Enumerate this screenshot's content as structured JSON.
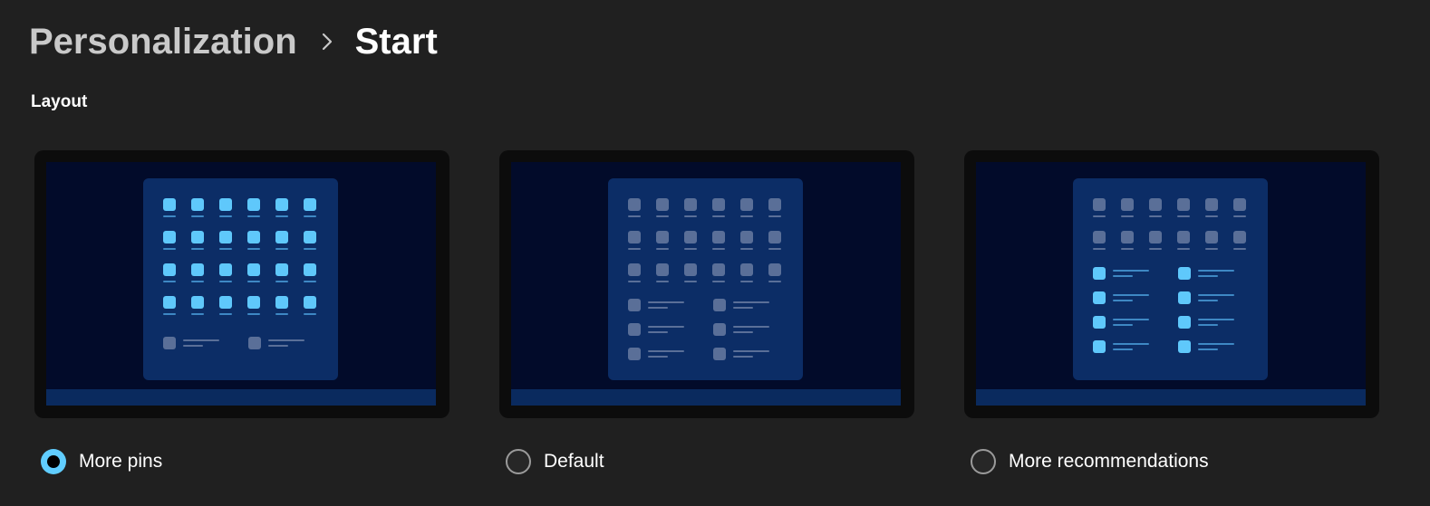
{
  "header": {
    "parent": "Personalization",
    "separator_icon": "chevron-right-icon",
    "current": "Start"
  },
  "section": {
    "title": "Layout"
  },
  "options": [
    {
      "id": "more-pins",
      "label": "More pins",
      "selected": true
    },
    {
      "id": "default",
      "label": "Default",
      "selected": false
    },
    {
      "id": "more-recommendations",
      "label": "More recommendations",
      "selected": false
    }
  ],
  "colors": {
    "background": "#202020",
    "accent": "#60cdff",
    "preview_screen": "#020b2a",
    "start_menu": "#0c2d66",
    "highlighted_item": "#5fc8fb",
    "muted_item": "#5a6f98"
  }
}
